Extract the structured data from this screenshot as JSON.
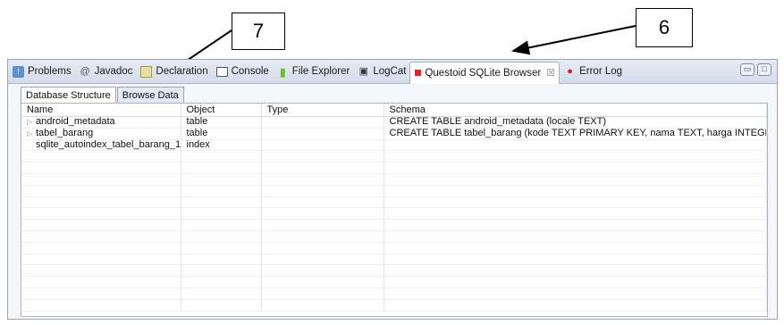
{
  "callouts": {
    "seven": "7",
    "six": "6"
  },
  "view_tabs": [
    {
      "label": "Problems",
      "icon": "problems-icon"
    },
    {
      "label": "Javadoc",
      "icon": "javadoc-icon"
    },
    {
      "label": "Declaration",
      "icon": "declaration-icon"
    },
    {
      "label": "Console",
      "icon": "console-icon"
    },
    {
      "label": "File Explorer",
      "icon": "android-icon"
    },
    {
      "label": "LogCat",
      "icon": "logcat-icon"
    },
    {
      "label": "Questoid SQLite Browser",
      "icon": "sqlite-icon",
      "close": "☒"
    },
    {
      "label": "Error Log",
      "icon": "error-log-icon"
    }
  ],
  "window_buttons": {
    "minimize": "▭",
    "maximize": "□"
  },
  "subtabs": [
    {
      "label": "Database Structure"
    },
    {
      "label": "Browse Data"
    }
  ],
  "table": {
    "headers": [
      "Name",
      "Object",
      "Type",
      "Schema"
    ],
    "rows": [
      {
        "expander": "▷",
        "name": "android_metadata",
        "object": "table",
        "type": "",
        "schema": "CREATE TABLE android_metadata (locale TEXT)"
      },
      {
        "expander": "▷",
        "name": "tabel_barang",
        "object": "table",
        "type": "",
        "schema": "CREATE TABLE tabel_barang (kode TEXT PRIMARY KEY, nama TEXT, harga INTEGER, ju"
      },
      {
        "expander": "",
        "name": "sqlite_autoindex_tabel_barang_1",
        "object": "index",
        "type": "",
        "schema": ""
      }
    ],
    "empty_rows": 14
  }
}
